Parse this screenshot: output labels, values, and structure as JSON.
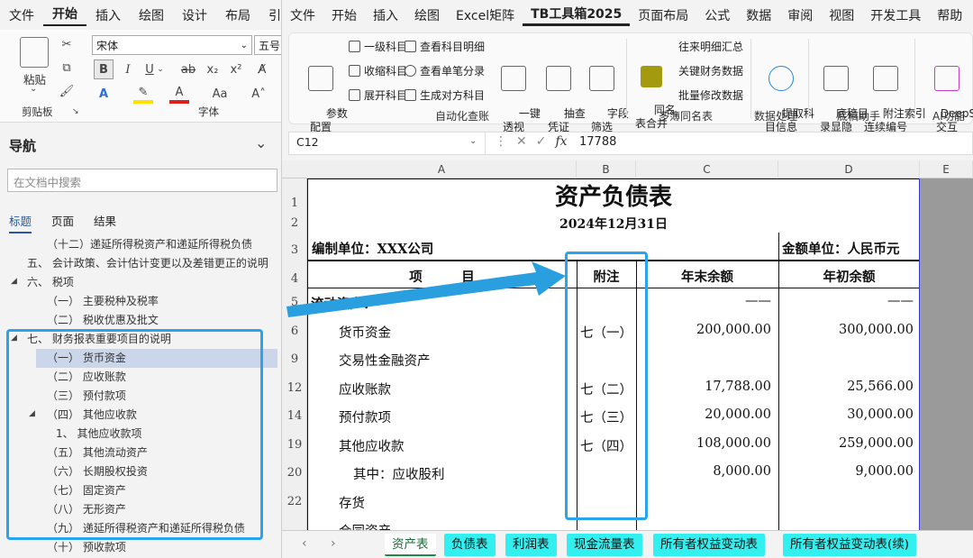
{
  "word": {
    "menu": [
      "文件",
      "开始",
      "插入",
      "绘图",
      "设计",
      "布局",
      "引"
    ],
    "menu_active": 1,
    "ribbon": {
      "paste_label": "粘贴",
      "clipboard_label": "剪贴板",
      "font_name": "宋体",
      "font_size": "五号",
      "font_group_label": "字体"
    },
    "nav": {
      "title": "导航",
      "search_placeholder": "在文档中搜索",
      "tabs": [
        "标题",
        "页面",
        "结果"
      ],
      "items": [
        {
          "text": "（十二）递延所得税资产和递延所得税负债",
          "level": 2
        },
        {
          "text": "五、 会计政策、会计估计变更以及差错更正的说明",
          "level": 1
        },
        {
          "text": "六、 税项",
          "level": 1,
          "expanded": true
        },
        {
          "text": "（一） 主要税种及税率",
          "level": 2
        },
        {
          "text": "（二） 税收优惠及批文",
          "level": 2
        },
        {
          "text": "七、 财务报表重要项目的说明",
          "level": 1,
          "expanded": true
        },
        {
          "text": "（一） 货币资金",
          "level": 2,
          "selected": true
        },
        {
          "text": "（二） 应收账款",
          "level": 2
        },
        {
          "text": "（三） 预付款项",
          "level": 2
        },
        {
          "text": "（四） 其他应收款",
          "level": 2,
          "expanded": true
        },
        {
          "text": "1、 其他应收款项",
          "level": 3
        },
        {
          "text": "（五） 其他流动资产",
          "level": 2
        },
        {
          "text": "（六） 长期股权投资",
          "level": 2
        },
        {
          "text": "（七） 固定资产",
          "level": 2
        },
        {
          "text": "（八） 无形资产",
          "level": 2
        },
        {
          "text": "（九） 递延所得税资产和递延所得税负债",
          "level": 2
        },
        {
          "text": "（十） 预收款项",
          "level": 2
        }
      ]
    }
  },
  "excel": {
    "menu": [
      "文件",
      "开始",
      "插入",
      "绘图",
      "Excel矩阵",
      "TB工具箱2025",
      "页面布局",
      "公式",
      "数据",
      "审阅",
      "视图",
      "开发工具",
      "帮助"
    ],
    "menu_active": 5,
    "ribbon": {
      "params": "参数\n配置",
      "lvl1": "一级科目",
      "collect": "收缩科目",
      "expand": "展开科目",
      "q_detail": "查看科目明细",
      "q_single": "查看单笔分录",
      "gen_opp": "生成对方科目",
      "pivot": "一键\n透视",
      "voucher": "抽查\n凭证",
      "field": "字段\n筛选",
      "auto_group": "自动化查账",
      "same_merge": "同名\n表合并",
      "detail_sum": "往来明细汇总",
      "key_data": "关键财务数据",
      "batch_edit": "批量修改数据",
      "multi_group": "多簿同名表",
      "extract": "提取科\n目信息",
      "data_group": "数据处理",
      "show_hide": "底稿目\n录显隐",
      "index": "附注索引\n连续编号",
      "draft_group": "底稿助手",
      "deepseek": "DeepSeek\n交互",
      "ai_group": "AI功能"
    },
    "namebox": "C12",
    "formula": "17788",
    "columns": [
      "A",
      "B",
      "C",
      "D",
      "E"
    ],
    "sheet": {
      "title": "资产负债表",
      "date": "2024年12月31日",
      "unit": "编制单位：XXX公司",
      "currency": "金额单位：人民币元",
      "headers": {
        "item": "项　　　目",
        "note": "附注",
        "end": "年末余额",
        "begin": "年初余额"
      },
      "rows": [
        {
          "row": "5",
          "item": "流动资产：",
          "note": "",
          "end": "——",
          "begin": "——",
          "indent": 0
        },
        {
          "row": "6",
          "item": "货币资金",
          "note": "七（一）",
          "end": "200,000.00",
          "begin": "300,000.00",
          "indent": 1
        },
        {
          "row": "9",
          "item": "交易性金融资产",
          "note": "",
          "end": "",
          "begin": "",
          "indent": 1
        },
        {
          "row": "12",
          "item": "应收账款",
          "note": "七（二）",
          "end": "17,788.00",
          "begin": "25,566.00",
          "indent": 1
        },
        {
          "row": "14",
          "item": "预付款项",
          "note": "七（三）",
          "end": "20,000.00",
          "begin": "30,000.00",
          "indent": 1
        },
        {
          "row": "19",
          "item": "其他应收款",
          "note": "七（四）",
          "end": "108,000.00",
          "begin": "259,000.00",
          "indent": 1
        },
        {
          "row": "20",
          "item": "其中：应收股利",
          "note": "",
          "end": "8,000.00",
          "begin": "9,000.00",
          "indent": 2
        },
        {
          "row": "22",
          "item": "存货",
          "note": "",
          "end": "",
          "begin": "",
          "indent": 1
        },
        {
          "row": "",
          "item": "合同资产",
          "note": "",
          "end": "",
          "begin": "",
          "indent": 1
        }
      ]
    },
    "tabs": [
      "资产表",
      "负债表",
      "利润表",
      "现金流量表",
      "所有者权益变动表",
      "所有者权益变动表(续)"
    ],
    "tab_active": 0,
    "colors": {
      "highlight": "#2aa4ec",
      "tab_bg": "#33f0f0",
      "arrow": "#2a9fe0"
    }
  }
}
